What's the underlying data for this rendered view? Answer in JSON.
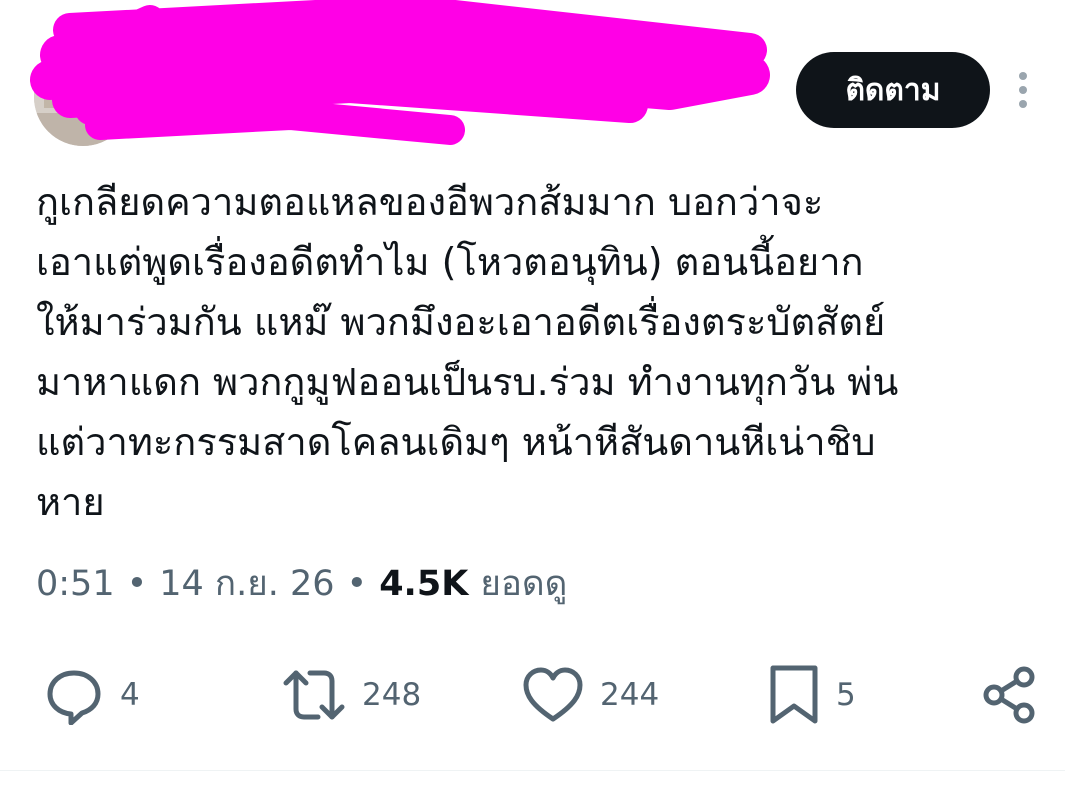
{
  "post": {
    "author_handle": "_",
    "follow_label": "ติดตาม",
    "text": "กูเกลียดความตอแหลของอีพวกส้มมาก บอกว่าจะ\nเอาแต่พูดเรื่องอดีตทำไม (โหวตอนุทิน) ตอนนี้อยาก\nให้มาร่วมกัน แหม๊ พวกมึงอะเอาอดีตเรื่องตระบัตสัตย์\nมาหาแดก พวกกูมูฟออนเป็นรบ.ร่วม ทำงานทุกวัน พ่น\nแต่วาทะกรรมสาดโคลนเดิมๆ หน้าหีสันดานหีเน่าชิบ\nหาย",
    "time": "0:51",
    "date": "14 ก.ย. 26",
    "separator": "•",
    "views_count": "4.5K",
    "views_label": "ยอดดู"
  },
  "actions": {
    "replies": "4",
    "reposts": "248",
    "likes": "244",
    "bookmarks": "5"
  },
  "icons": [
    "reply-icon",
    "repost-icon",
    "like-icon",
    "bookmark-icon",
    "share-icon",
    "more-icon"
  ],
  "colors": {
    "text": "#0f1419",
    "muted": "#536471",
    "button": "#0f1419",
    "redaction": "#ff00e6"
  }
}
